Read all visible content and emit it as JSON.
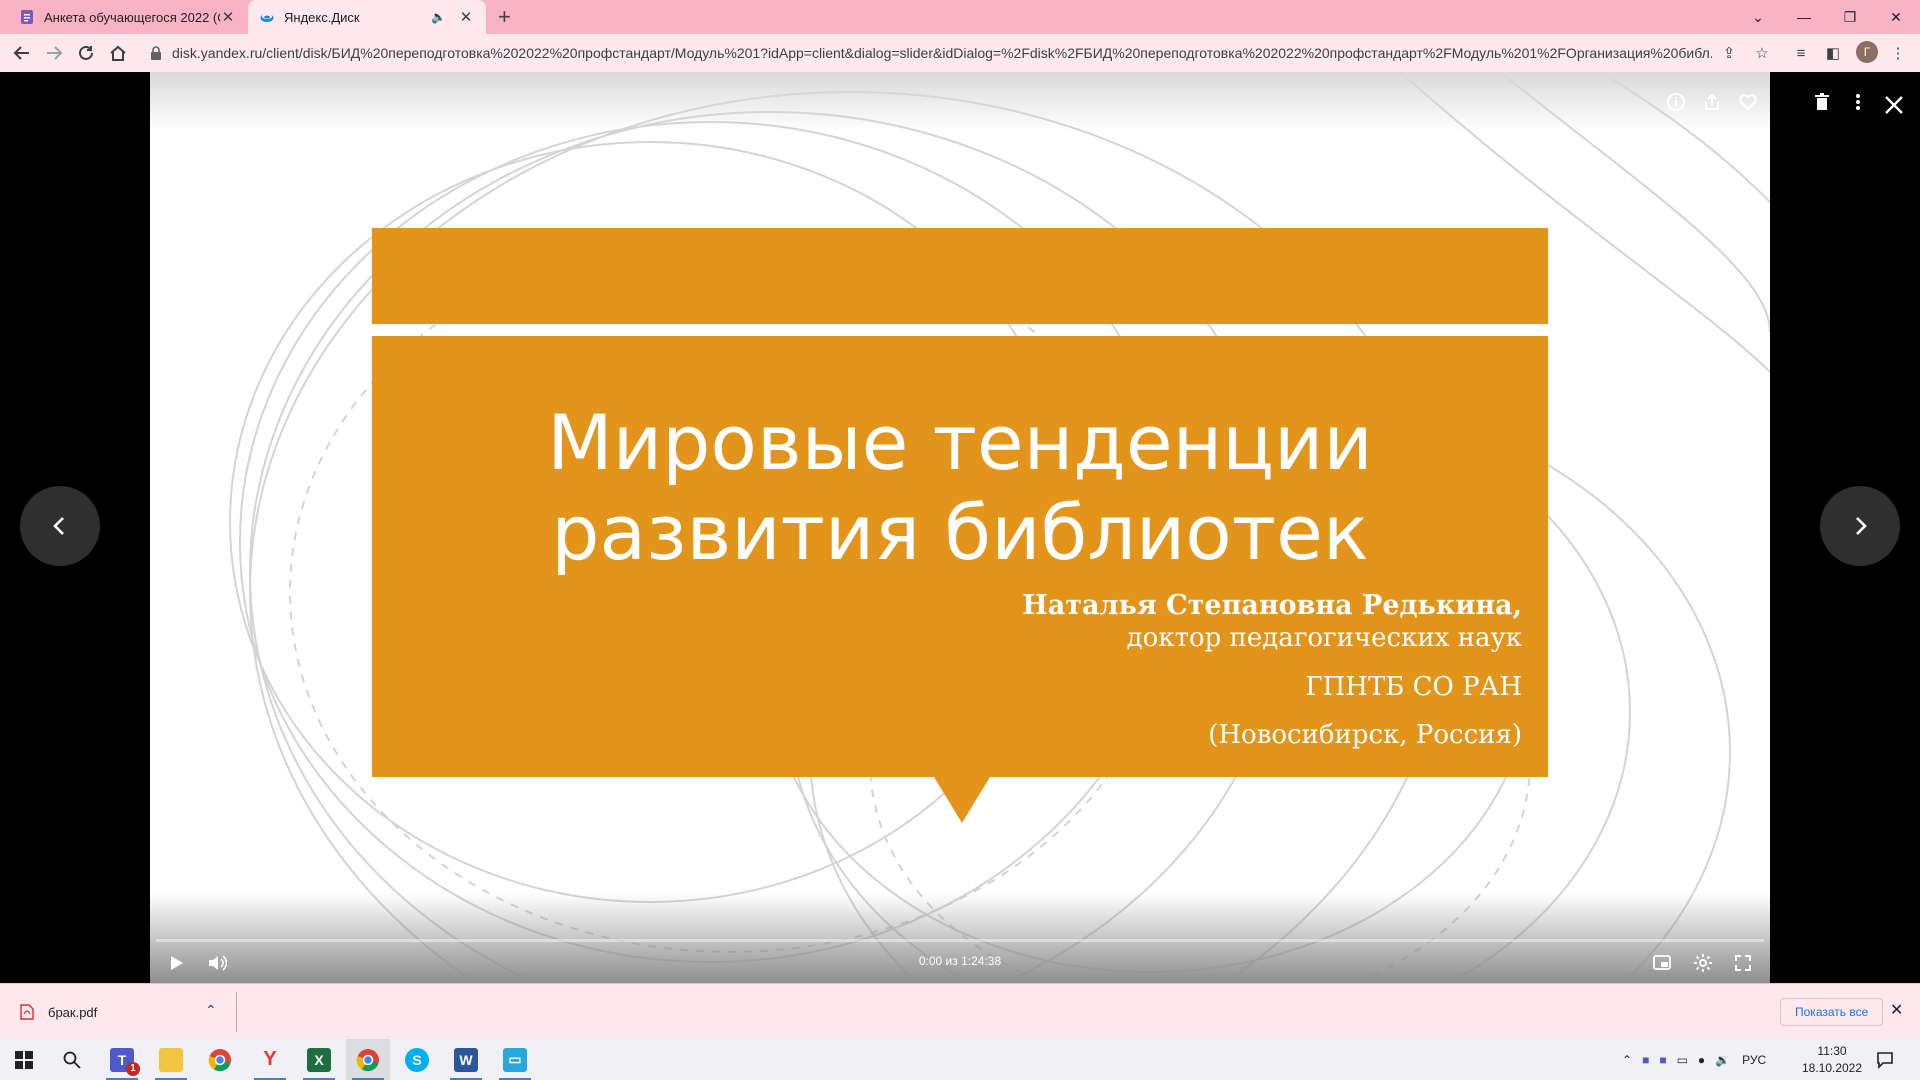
{
  "browser": {
    "tabs": [
      {
        "title": "Анкета обучающегося 2022 (От",
        "active": false
      },
      {
        "title": "Яндекс.Диск",
        "active": true
      }
    ],
    "url": "disk.yandex.ru/client/disk/БИД%20переподготовка%202022%20профстандарт/Модуль%201?idApp=client&dialog=slider&idDialog=%2Fdisk%2FБИД%20переподготовка%202022%20профстандарт%2FМодуль%201%2FОрганизация%20библ...",
    "profile_initial": "Г"
  },
  "slide": {
    "title_line1": "Мировые тенденции",
    "title_line2": "развития библиотек",
    "author": "Наталья Степановна Редькина,",
    "degree": "доктор педагогических наук",
    "organization": "ГПНТБ СО РАН",
    "location": "(Новосибирск, Россия)"
  },
  "player": {
    "timecode": "0:00 из 1:24:38",
    "progress": 0
  },
  "downloads": {
    "file_name": "брак.pdf",
    "show_all_label": "Показать все"
  },
  "taskbar": {
    "language": "РУС",
    "time": "11:30",
    "date": "18.10.2022",
    "teams_badge": "1"
  },
  "colors": {
    "accent_orange": "#e3951b",
    "chrome_pink": "#f9b3c5",
    "chrome_light": "#fde8ee"
  }
}
